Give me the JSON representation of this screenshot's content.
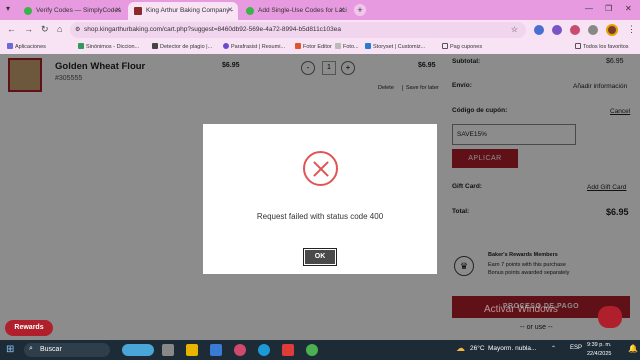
{
  "browser": {
    "tabs": [
      {
        "title": "Verify Codes — SimplyCodes",
        "active": false
      },
      {
        "title": "King Arthur Baking Company -",
        "active": true
      },
      {
        "title": "Add Single-Use Codes for Laci",
        "active": false
      }
    ],
    "new_tab": "+",
    "url": "shop.kingarthurbaking.com/cart.php?suggest=8460db92-569e-4a72-8994-b5d811c103ea",
    "bookmarks": [
      "Aplicaciones",
      "Sinónimos - Diccion...",
      "Detector de plagio |...",
      "Parafrasist | Resumi...",
      "Fotor Editor",
      "Foto...",
      "Storyset | Customiz...",
      "Pag cupones"
    ],
    "all_bookmarks": "Todos los favoritos"
  },
  "cart": {
    "product_name": "Golden Wheat Flour",
    "sku": "#305555",
    "unit_price": "$6.95",
    "qty_minus": "-",
    "quantity": "1",
    "qty_plus": "+",
    "line_total": "$6.95",
    "delete": "Delete",
    "save_for_later": "Save for later"
  },
  "summary": {
    "subtotal_label": "Subtotal:",
    "subtotal_value": "$6.95",
    "shipping_label": "Envío:",
    "shipping_action": "Añadir información",
    "coupon_label": "Código de cupón:",
    "coupon_cancel": "Cancel",
    "coupon_value": "SAVE15%",
    "apply_label": "APLICAR",
    "gift_label": "Gift Card:",
    "gift_action": "Add Gift Card",
    "total_label": "Total:",
    "total_value": "$6.95",
    "rewards_title": "Baker's Rewards Members",
    "rewards_line1": "Earn 7 points with this purchase",
    "rewards_line2": "Bonus points awarded separately",
    "checkout": "PROCESO DE PAGO",
    "or_use": "-- or use --"
  },
  "rewards_button": "Rewards",
  "watermark": "Activar Windows",
  "modal": {
    "message": "Request failed with status code 400",
    "ok_label": "OK"
  },
  "taskbar": {
    "search": "Buscar",
    "weather_temp": "26°C",
    "weather_text": "Mayorm. nubla...",
    "lang": "ESP",
    "time": "9:39 p. m.",
    "date": "22/4/2025"
  },
  "colors": {
    "brand_red": "#b0202c",
    "tab_bar": "#e79ae0",
    "error": "#e25454"
  }
}
